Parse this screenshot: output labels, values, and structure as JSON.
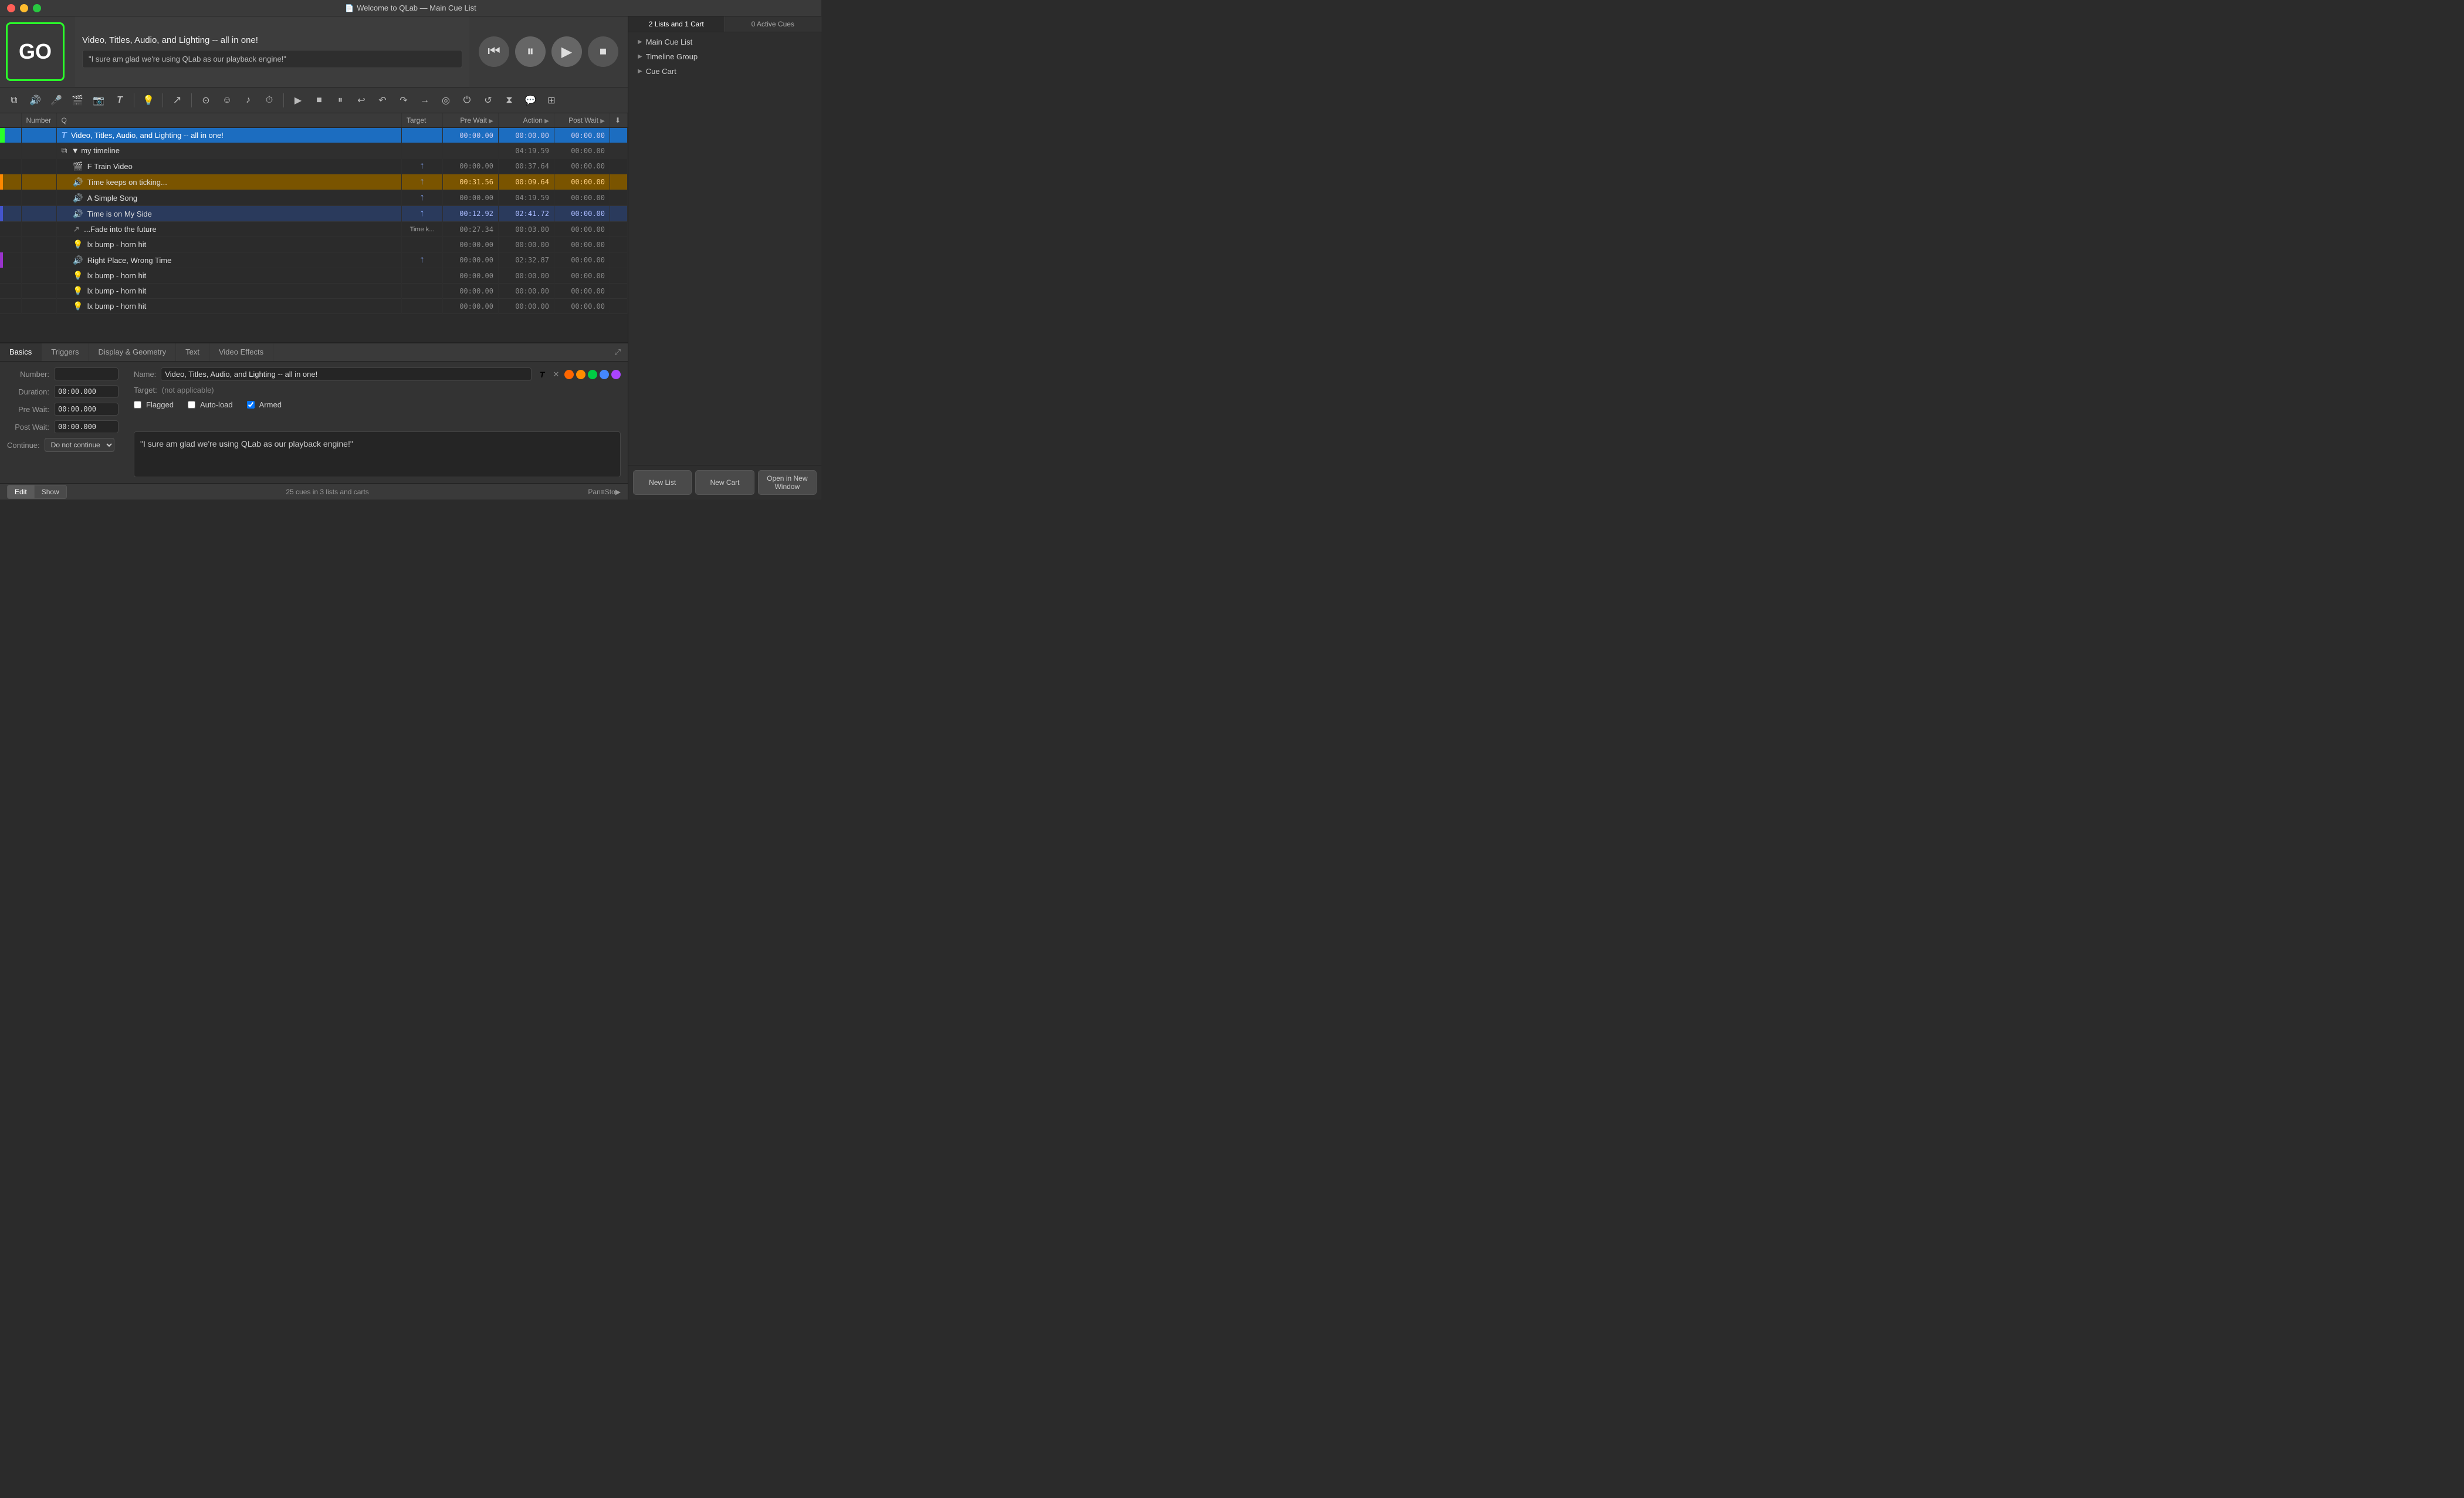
{
  "titleBar": {
    "title": "Welcome to QLab — Main Cue List",
    "icon": "📄"
  },
  "header": {
    "line1": "Video, Titles, Audio, and Lighting -- all in one!",
    "line2": "\"I sure am glad we're using QLab as our playback engine!\""
  },
  "toolbar": {
    "buttons": [
      {
        "id": "copy",
        "icon": "⧉",
        "label": "copy"
      },
      {
        "id": "audio",
        "icon": "🔊",
        "label": "audio"
      },
      {
        "id": "mic",
        "icon": "🎤",
        "label": "microphone"
      },
      {
        "id": "video",
        "icon": "🎬",
        "label": "video"
      },
      {
        "id": "camera",
        "icon": "📷",
        "label": "camera"
      },
      {
        "id": "text",
        "icon": "T",
        "label": "text"
      },
      {
        "id": "light",
        "icon": "💡",
        "label": "light"
      },
      {
        "id": "fade",
        "icon": "↗",
        "label": "fade"
      },
      {
        "id": "target",
        "icon": "⊙",
        "label": "target"
      },
      {
        "id": "emoji",
        "icon": "☺",
        "label": "emoji"
      },
      {
        "id": "music",
        "icon": "♪",
        "label": "music"
      },
      {
        "id": "clock",
        "icon": "⏱",
        "label": "clock"
      },
      {
        "id": "play",
        "icon": "▶",
        "label": "transport-play"
      },
      {
        "id": "stop2",
        "icon": "■",
        "label": "transport-stop"
      },
      {
        "id": "pause",
        "icon": "⏸",
        "label": "transport-pause"
      },
      {
        "id": "back",
        "icon": "↩",
        "label": "transport-back"
      },
      {
        "id": "undo",
        "icon": "↶",
        "label": "undo"
      },
      {
        "id": "redo",
        "icon": "↷",
        "label": "redo"
      },
      {
        "id": "next",
        "icon": "→",
        "label": "next"
      },
      {
        "id": "target2",
        "icon": "◎",
        "label": "target2"
      },
      {
        "id": "power",
        "icon": "⏻",
        "label": "power"
      },
      {
        "id": "loop",
        "icon": "↺",
        "label": "loop"
      },
      {
        "id": "hourglass",
        "icon": "⧗",
        "label": "hourglass"
      },
      {
        "id": "speech",
        "icon": "💬",
        "label": "speech"
      },
      {
        "id": "grid",
        "icon": "⊞",
        "label": "grid"
      }
    ]
  },
  "cueTable": {
    "columns": [
      "",
      "Number",
      "Q",
      "Target",
      "Pre Wait",
      "Action",
      "Post Wait",
      ""
    ],
    "rows": [
      {
        "icon": "T",
        "iconType": "text-cue",
        "number": "",
        "name": "Video, Titles, Audio, and Lighting -- all in one!",
        "target": "",
        "preWait": "00:00.00",
        "action": "00:00.00",
        "postWait": "00:00.00",
        "selected": true,
        "indent": 0
      },
      {
        "icon": "⧉",
        "iconType": "group-cue",
        "number": "",
        "name": "▼ my timeline",
        "target": "",
        "preWait": "",
        "action": "04:19.59",
        "postWait": "00:00.00",
        "selected": false,
        "indent": 0
      },
      {
        "icon": "🎬",
        "iconType": "video-cue",
        "number": "",
        "name": "F Train Video",
        "target": "↑",
        "preWait": "00:00.00",
        "action": "00:37.64",
        "postWait": "00:00.00",
        "selected": false,
        "indent": 1
      },
      {
        "icon": "🔊",
        "iconType": "audio-cue",
        "number": "",
        "name": "Time keeps on ticking...",
        "target": "↑",
        "preWait": "00:31.56",
        "action": "00:09.64",
        "postWait": "00:00.00",
        "selected": false,
        "indent": 1,
        "activeOrange": true
      },
      {
        "icon": "🔊",
        "iconType": "audio-cue",
        "number": "",
        "name": "A Simple Song",
        "target": "↑",
        "preWait": "00:00.00",
        "action": "04:19.59",
        "postWait": "00:00.00",
        "selected": false,
        "indent": 1
      },
      {
        "icon": "🔊",
        "iconType": "audio-cue",
        "number": "",
        "name": "Time is on My Side",
        "target": "↑",
        "preWait": "00:12.92",
        "action": "02:41.72",
        "postWait": "00:00.00",
        "selected": false,
        "indent": 1,
        "activeBlue": true
      },
      {
        "icon": "↗",
        "iconType": "fade-cue",
        "number": "",
        "name": "...Fade into the future",
        "target": "Time k...",
        "preWait": "00:27.34",
        "action": "00:03.00",
        "postWait": "00:00.00",
        "selected": false,
        "indent": 1
      },
      {
        "icon": "💡",
        "iconType": "light-cue",
        "number": "",
        "name": "lx bump - horn hit",
        "target": "",
        "preWait": "00:00.00",
        "action": "00:00.00",
        "postWait": "00:00.00",
        "selected": false,
        "indent": 1
      },
      {
        "icon": "🔊",
        "iconType": "audio-cue",
        "number": "",
        "name": "Right Place, Wrong Time",
        "target": "↑",
        "preWait": "00:00.00",
        "action": "02:32.87",
        "postWait": "00:00.00",
        "selected": false,
        "indent": 1,
        "activePurple": true
      },
      {
        "icon": "💡",
        "iconType": "light-cue",
        "number": "",
        "name": "lx bump - horn hit",
        "target": "",
        "preWait": "00:00.00",
        "action": "00:00.00",
        "postWait": "00:00.00",
        "selected": false,
        "indent": 1
      },
      {
        "icon": "💡",
        "iconType": "light-cue",
        "number": "",
        "name": "lx bump - horn hit",
        "target": "",
        "preWait": "00:00.00",
        "action": "00:00.00",
        "postWait": "00:00.00",
        "selected": false,
        "indent": 1
      },
      {
        "icon": "💡",
        "iconType": "light-cue",
        "number": "",
        "name": "lx bump - horn hit",
        "target": "",
        "preWait": "00:00.00",
        "action": "00:00.00",
        "postWait": "00:00.00",
        "selected": false,
        "indent": 1
      }
    ]
  },
  "rightPanel": {
    "listsTab": "2 Lists and 1 Cart",
    "activeCuesTab": "0 Active Cues",
    "cueItems": [
      {
        "name": "Main Cue List",
        "icon": "▶"
      },
      {
        "name": "Timeline Group",
        "icon": "▶"
      },
      {
        "name": "Cue Cart",
        "icon": "▶"
      }
    ],
    "bottomButtons": {
      "newList": "New List",
      "newCart": "New Cart",
      "openWindow": "Open in New Window"
    }
  },
  "transport": {
    "goLabel": "GO"
  },
  "inspector": {
    "tabs": [
      "Basics",
      "Triggers",
      "Display & Geometry",
      "Text",
      "Video Effects"
    ],
    "activeTab": "Basics",
    "fields": {
      "numberLabel": "Number:",
      "numberValue": "",
      "nameLabel": "Name:",
      "nameValue": "Video, Titles, Audio, and Lighting -- all in one!",
      "durationLabel": "Duration:",
      "durationValue": "00:00.000",
      "targetLabel": "Target:",
      "targetValue": "(not applicable)",
      "preWaitLabel": "Pre Wait:",
      "preWaitValue": "00:00.000",
      "postWaitLabel": "Post Wait:",
      "postWaitValue": "00:00.000",
      "continueLabel": "Continue:",
      "continueValue": "Do not continue",
      "flaggedLabel": "Flagged",
      "autoLoadLabel": "Auto-load",
      "armedLabel": "Armed",
      "flaggedChecked": false,
      "autoLoadChecked": false,
      "armedChecked": true
    },
    "previewText": "\"I sure am glad we're using QLab as our playback engine!\"",
    "colorDots": [
      "#ff6600",
      "#ff8c00",
      "#00cc44",
      "#4488ff",
      "#aa44ff"
    ]
  },
  "statusBar": {
    "text": "25 cues in 3 lists and carts",
    "editTab": "Edit",
    "showTab": "Show",
    "rightText": "Pan≡Sto▶"
  }
}
